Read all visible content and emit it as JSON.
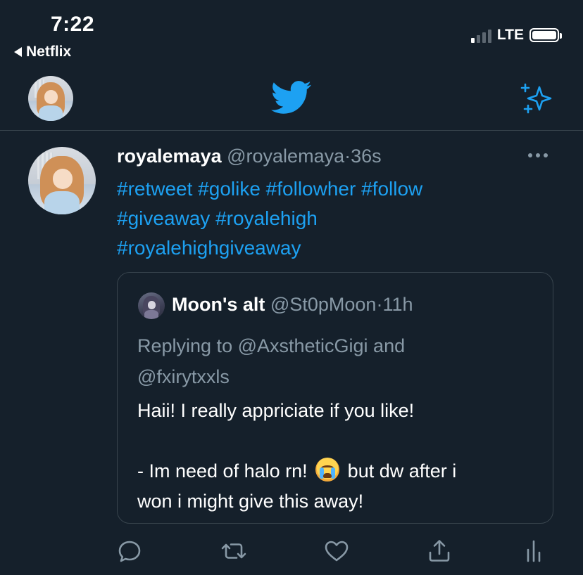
{
  "status_bar": {
    "time": "7:22",
    "back_app": "Netflix",
    "network": "LTE"
  },
  "nav": {
    "logo_icon": "twitter-bird-icon",
    "sparkle_icon": "sparkle-icon",
    "accent": "#1da1f2"
  },
  "tweet": {
    "display_name": "royalemaya",
    "handle": "@royalemaya",
    "separator": "·",
    "age": "36s",
    "hashtags_line1": "#retweet #golike #followher #follow",
    "hashtags_line2": "#giveaway #royalehigh",
    "hashtags_line3": "#royalehighgiveaway"
  },
  "quoted": {
    "display_name": "Moon's alt",
    "handle": "@St0pMoon",
    "separator": "·",
    "age": "11h",
    "reply_line1": "Replying to @AxstheticGigi and",
    "reply_line2": "@fxirytxxls",
    "body_line1": "Haii! I really appriciate if you like!",
    "body_line3_a": "- Im need of halo rn!",
    "body_line3_b": "but dw after i",
    "body_line4": "won i might give this away!"
  },
  "actions": [
    "reply-icon",
    "retweet-icon",
    "like-icon",
    "share-icon",
    "analytics-icon"
  ],
  "colors": {
    "background": "#15202b",
    "muted": "#8899a6",
    "border": "#38444d"
  }
}
